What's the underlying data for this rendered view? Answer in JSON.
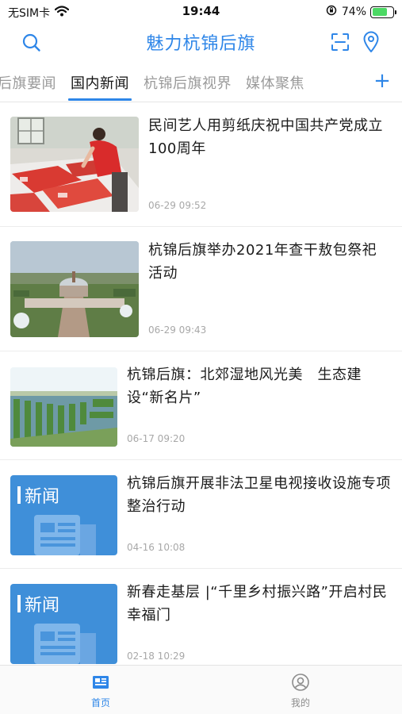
{
  "status_bar": {
    "carrier": "无SIM卡",
    "time": "19:44",
    "battery": "74%",
    "battery_level": 0.74
  },
  "header": {
    "title": "魅力杭锦后旗",
    "search_icon": "search-icon",
    "scan_icon": "scan-icon",
    "location_icon": "location-pin-icon"
  },
  "tabs": [
    {
      "label": "后旗要闻",
      "active": false
    },
    {
      "label": "国内新闻",
      "active": true
    },
    {
      "label": "杭锦后旗视界",
      "active": false
    },
    {
      "label": "媒体聚焦",
      "active": false
    }
  ],
  "tab_add_label": "+",
  "news": [
    {
      "title": "民间艺人用剪纸庆祝中国共产党成立100周年",
      "date": "06-29 09:52",
      "thumb": "papercut-photo"
    },
    {
      "title": "杭锦后旗举办2021年查干敖包祭祀活动",
      "date": "06-29 09:43",
      "thumb": "aobao-photo"
    },
    {
      "title": "杭锦后旗：北郊湿地风光美　生态建设“新名片”",
      "date": "06-17 09:20",
      "thumb": "wetland-photo"
    },
    {
      "title": "杭锦后旗开展非法卫星电视接收设施专项整治行动",
      "date": "04-16 10:08",
      "thumb": "news-placeholder",
      "thumb_label": "新闻"
    },
    {
      "title": "新春走基层 |“千里乡村振兴路”开启村民幸福门",
      "date": "02-18 10:29",
      "thumb": "news-placeholder",
      "thumb_label": "新闻"
    }
  ],
  "bottom_nav": [
    {
      "label": "首页",
      "icon": "newspaper-icon",
      "active": true
    },
    {
      "label": "我的",
      "icon": "user-icon",
      "active": false
    }
  ],
  "colors": {
    "accent": "#2e86e8",
    "inactive_tab": "#9a9a9a",
    "date": "#a8a8a8",
    "placeholder_blue": "#3f8fd9"
  }
}
